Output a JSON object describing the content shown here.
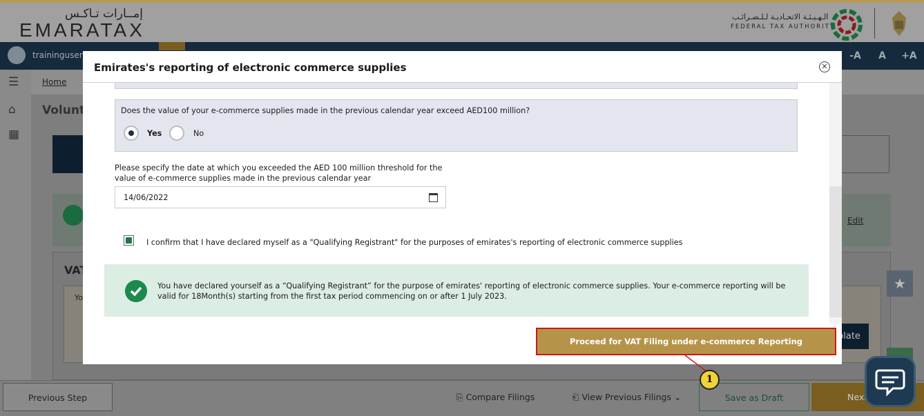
{
  "header": {
    "logo_ar": "إمــارات تـاكـس",
    "logo_en": "EMARATAX",
    "fta_ar": "الـهـيـئـة الاتحـاديـة لـلـضـرائـب",
    "fta_en": "FEDERAL TAX AUTHORITY"
  },
  "userbar": {
    "username": "traininguser_",
    "font_buttons": [
      "-A",
      "A",
      "+A"
    ]
  },
  "breadcrumb": {
    "home": "Home"
  },
  "background": {
    "page_title": "Volunta",
    "edit_link": "Edit",
    "vat_section": "VAT",
    "vat_inner_text": "Yo",
    "update_button": "plate"
  },
  "modal": {
    "title": "Emirates's reporting of electronic commerce supplies",
    "question": "Does the value of your e-commerce supplies made in the previous calendar year exceed AED100 million?",
    "options": [
      {
        "label": "Yes",
        "selected": true
      },
      {
        "label": "No",
        "selected": false
      }
    ],
    "date_label": "Please specify the date at which you exceeded the AED 100 million threshold for the value of e-commerce supplies made in the previous calendar year",
    "date_value": "14/06/2022",
    "confirm_text": "I confirm that I have declared myself as a \"Qualifying Registrant\" for the purposes of emirates's reporting of electronic commerce supplies",
    "confirm_checked": true,
    "success_message": "You have declared yourself as a “Qualifying Registrant” for the purpose of emirates' reporting of electronic commerce supplies. Your e-commerce reporting will be valid for 18Month(s) starting from the first tax period commencing on or after 1 July 2023.",
    "proceed_button": "Proceed for VAT Filing under e-commerce Reporting"
  },
  "footer": {
    "previous": "Previous Step",
    "compare": "Compare Filings",
    "view_previous": "View Previous Filings",
    "save_draft": "Save as Draft",
    "next": "Next"
  },
  "callout": {
    "number": "1"
  },
  "colors": {
    "gold": "#b5944a",
    "navy": "#152a3d",
    "green": "#1b8a4c",
    "highlight_red": "#d01616"
  }
}
